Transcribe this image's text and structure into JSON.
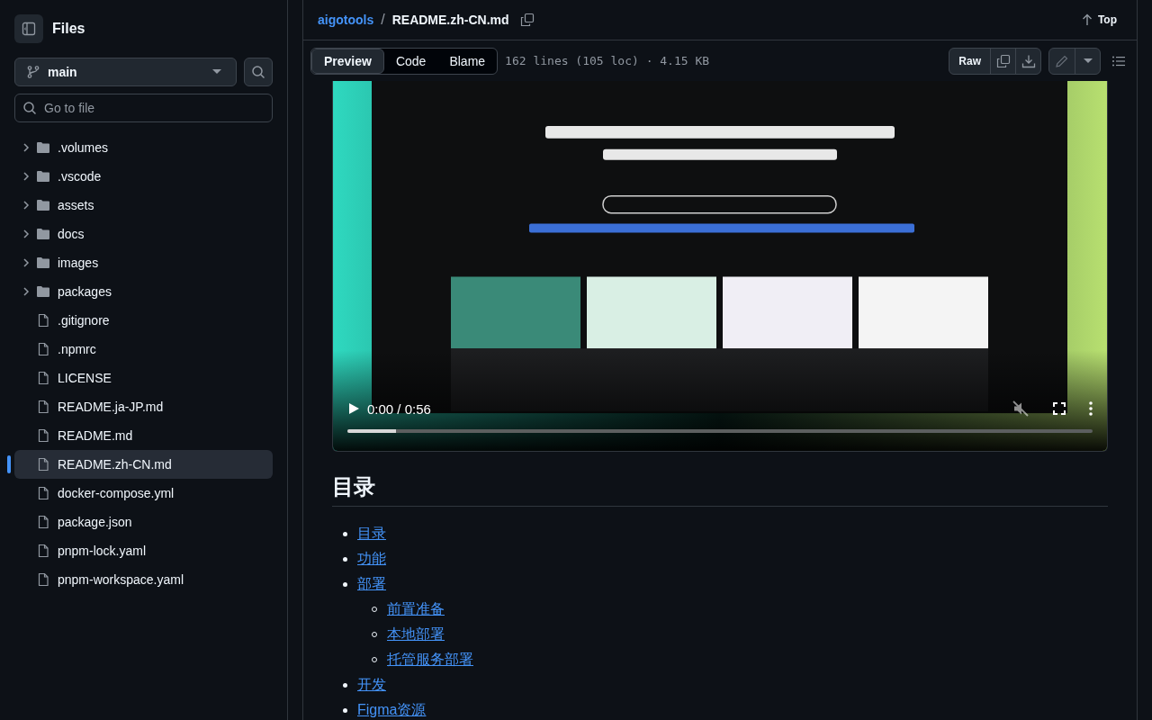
{
  "sidebar": {
    "title": "Files",
    "branch": "main",
    "search_placeholder": "Go to file",
    "tree": [
      {
        "name": ".volumes",
        "kind": "folder",
        "selected": false
      },
      {
        "name": ".vscode",
        "kind": "folder",
        "selected": false
      },
      {
        "name": "assets",
        "kind": "folder",
        "selected": false
      },
      {
        "name": "docs",
        "kind": "folder",
        "selected": false
      },
      {
        "name": "images",
        "kind": "folder",
        "selected": false
      },
      {
        "name": "packages",
        "kind": "folder",
        "selected": false
      },
      {
        "name": ".gitignore",
        "kind": "file",
        "selected": false
      },
      {
        "name": ".npmrc",
        "kind": "file",
        "selected": false
      },
      {
        "name": "LICENSE",
        "kind": "file",
        "selected": false
      },
      {
        "name": "README.ja-JP.md",
        "kind": "file",
        "selected": false
      },
      {
        "name": "README.md",
        "kind": "file",
        "selected": false
      },
      {
        "name": "README.zh-CN.md",
        "kind": "file",
        "selected": true
      },
      {
        "name": "docker-compose.yml",
        "kind": "file",
        "selected": false
      },
      {
        "name": "package.json",
        "kind": "file",
        "selected": false
      },
      {
        "name": "pnpm-lock.yaml",
        "kind": "file",
        "selected": false
      },
      {
        "name": "pnpm-workspace.yaml",
        "kind": "file",
        "selected": false
      }
    ]
  },
  "header": {
    "repo": "aigotools",
    "separator": "/",
    "file": "README.zh-CN.md",
    "top": "Top"
  },
  "toolbar": {
    "tabs": [
      {
        "label": "Preview",
        "selected": true
      },
      {
        "label": "Code",
        "selected": false
      },
      {
        "label": "Blame",
        "selected": false
      }
    ],
    "file_info": "162 lines (105 loc) · 4.15 KB",
    "raw": "Raw"
  },
  "video": {
    "kind": "picture",
    "time": "0:00 / 0:56",
    "muted": true,
    "level": 0.065
  },
  "heading": "目录",
  "toc": [
    {
      "label": "目录"
    },
    {
      "label": "功能"
    },
    {
      "label": "部署",
      "children": [
        {
          "label": "前置准备"
        },
        {
          "label": "本地部署"
        },
        {
          "label": "托管服务部署"
        }
      ]
    },
    {
      "label": "开发"
    },
    {
      "label": "Figma资源"
    }
  ]
}
